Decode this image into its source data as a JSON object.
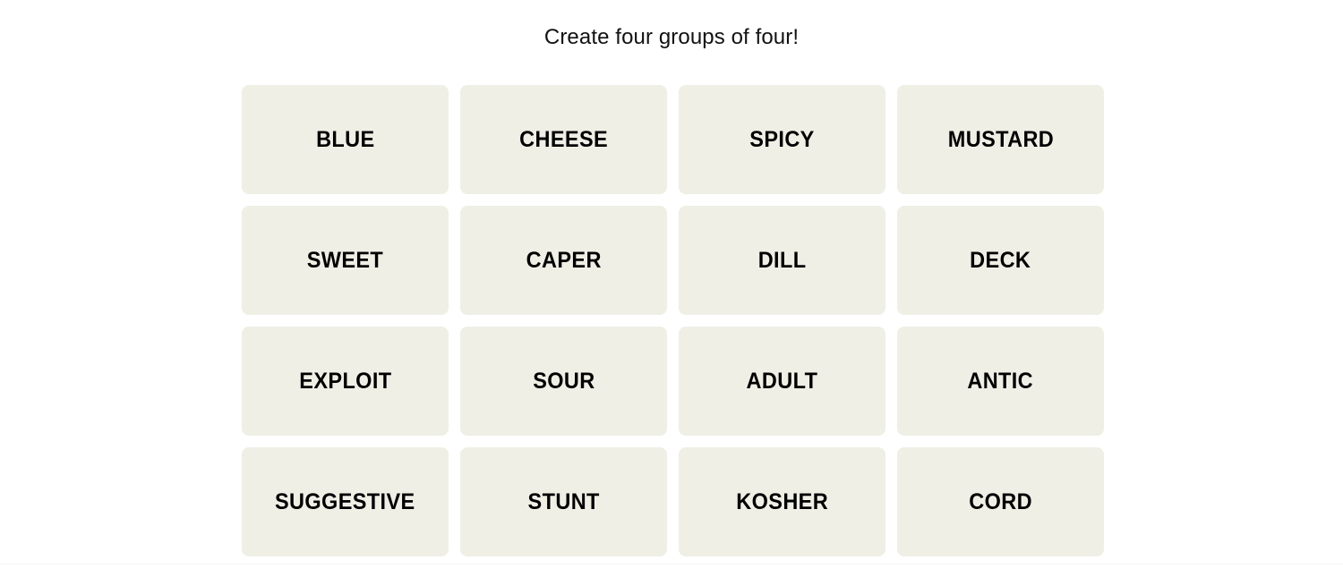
{
  "header": {
    "instruction": "Create four groups of four!"
  },
  "colors": {
    "page_background": "#ffffff",
    "tile_background": "#efefe6",
    "tile_text": "#000000",
    "title_text": "#121212",
    "divider": "#f4f4f4"
  },
  "board": {
    "rows": 4,
    "columns": 4,
    "tiles": [
      {
        "label": "BLUE"
      },
      {
        "label": "CHEESE"
      },
      {
        "label": "SPICY"
      },
      {
        "label": "MUSTARD"
      },
      {
        "label": "SWEET"
      },
      {
        "label": "CAPER"
      },
      {
        "label": "DILL"
      },
      {
        "label": "DECK"
      },
      {
        "label": "EXPLOIT"
      },
      {
        "label": "SOUR"
      },
      {
        "label": "ADULT"
      },
      {
        "label": "ANTIC"
      },
      {
        "label": "SUGGESTIVE"
      },
      {
        "label": "STUNT"
      },
      {
        "label": "KOSHER"
      },
      {
        "label": "CORD"
      }
    ]
  }
}
